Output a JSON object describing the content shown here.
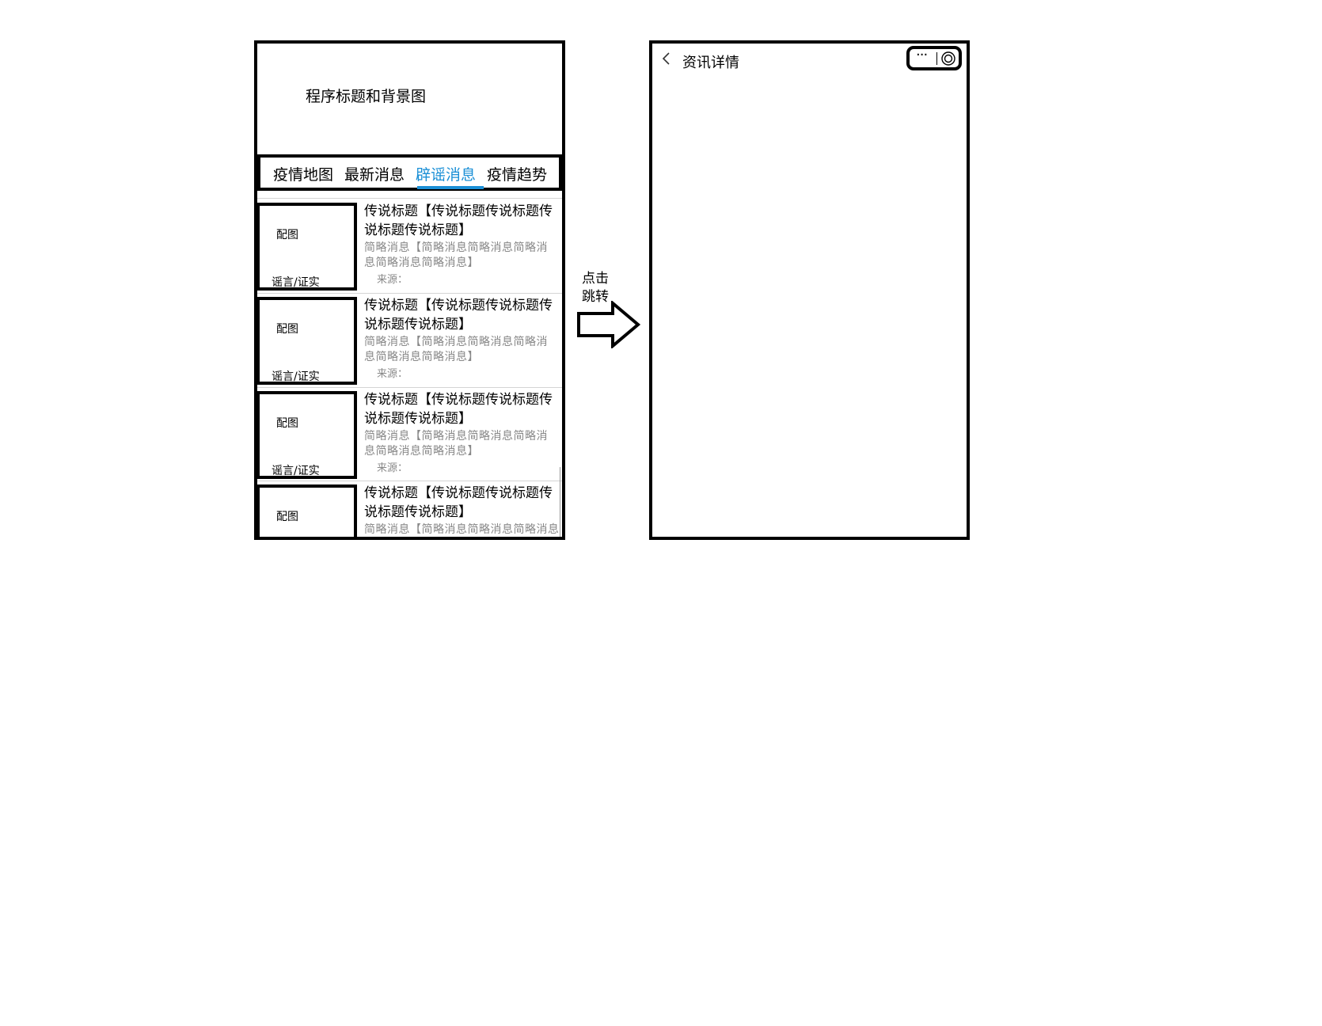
{
  "left_phone": {
    "header_title": "程序标题和背景图",
    "tabs": [
      {
        "label": "疫情地图",
        "active": false
      },
      {
        "label": "最新消息",
        "active": false
      },
      {
        "label": "辟谣消息",
        "active": true
      },
      {
        "label": "疫情趋势",
        "active": false
      }
    ],
    "accent_color": "#1a8fd6",
    "cards": [
      {
        "thumb_label": "配图",
        "tag": "谣言/证实",
        "title": "传说标题【传说标题传说标题传说标题传说标题】",
        "summary": "简略消息【简略消息简略消息简略消息简略消息简略消息】",
        "source": "来源："
      },
      {
        "thumb_label": "配图",
        "tag": "谣言/证实",
        "title": "传说标题【传说标题传说标题传说标题传说标题】",
        "summary": "简略消息【简略消息简略消息简略消息简略消息简略消息】",
        "source": "来源："
      },
      {
        "thumb_label": "配图",
        "tag": "谣言/证实",
        "title": "传说标题【传说标题传说标题传说标题传说标题】",
        "summary": "简略消息【简略消息简略消息简略消息简略消息简略消息】",
        "source": "来源："
      },
      {
        "thumb_label": "配图",
        "tag": "",
        "title": "传说标题【传说标题传说标题传说标题传说标题】",
        "summary": "简略消息【简略消息简略消息简略消息简略",
        "source": ""
      }
    ]
  },
  "arrow": {
    "label_line1": "点击",
    "label_line2": "跳转",
    "icon": "right-arrow-icon"
  },
  "right_phone": {
    "back_icon": "chevron-left-icon",
    "title": "资讯详情",
    "capsule": {
      "more_icon": "more-dots-icon",
      "more_glyph": "···",
      "close_icon": "target-circle-icon"
    }
  }
}
